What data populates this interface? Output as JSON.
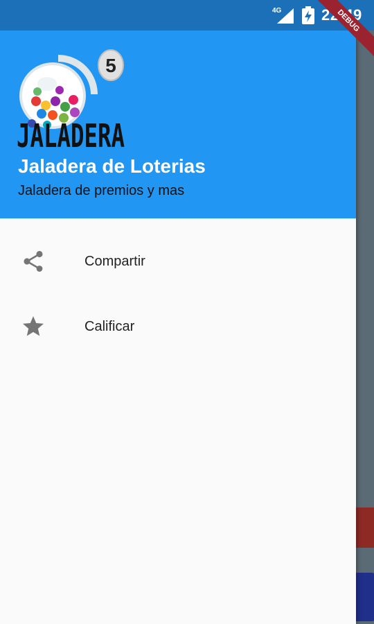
{
  "status_bar": {
    "network": "4G",
    "time": "22:49",
    "debug_label": "DEBUG"
  },
  "drawer": {
    "header": {
      "logo_text": "JALADERA",
      "logo_badge": "5",
      "title": "Jaladera de Loterias",
      "subtitle": "Jaladera de premios y mas"
    },
    "items": [
      {
        "label": "Compartir",
        "icon": "share-icon"
      },
      {
        "label": "Calificar",
        "icon": "star-icon"
      }
    ]
  },
  "colors": {
    "status_bar": "#1b70b8",
    "header": "#2196f3",
    "drawer_bg": "#fafafa",
    "icon": "#757575",
    "debug_banner": "#9b2330"
  }
}
